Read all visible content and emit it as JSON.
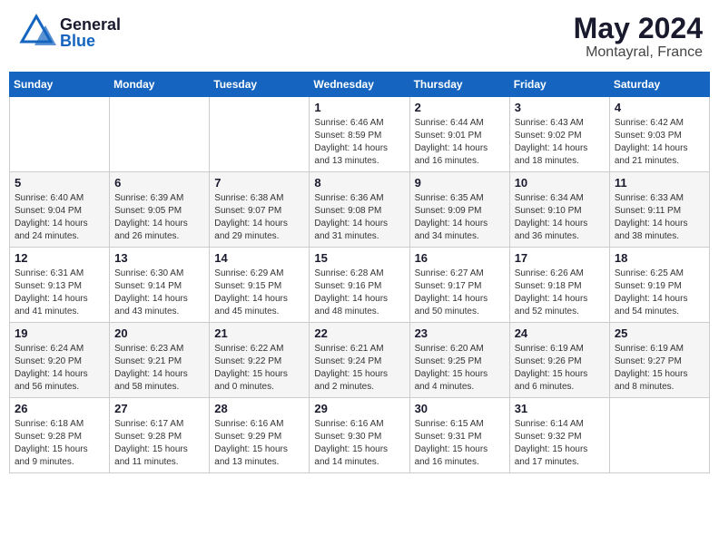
{
  "header": {
    "logo_general": "General",
    "logo_blue": "Blue",
    "month_year": "May 2024",
    "location": "Montayral, France"
  },
  "weekdays": [
    "Sunday",
    "Monday",
    "Tuesday",
    "Wednesday",
    "Thursday",
    "Friday",
    "Saturday"
  ],
  "weeks": [
    {
      "days": [
        {
          "number": "",
          "info": ""
        },
        {
          "number": "",
          "info": ""
        },
        {
          "number": "",
          "info": ""
        },
        {
          "number": "1",
          "sunrise": "Sunrise: 6:46 AM",
          "sunset": "Sunset: 8:59 PM",
          "daylight": "Daylight: 14 hours and 13 minutes."
        },
        {
          "number": "2",
          "sunrise": "Sunrise: 6:44 AM",
          "sunset": "Sunset: 9:01 PM",
          "daylight": "Daylight: 14 hours and 16 minutes."
        },
        {
          "number": "3",
          "sunrise": "Sunrise: 6:43 AM",
          "sunset": "Sunset: 9:02 PM",
          "daylight": "Daylight: 14 hours and 18 minutes."
        },
        {
          "number": "4",
          "sunrise": "Sunrise: 6:42 AM",
          "sunset": "Sunset: 9:03 PM",
          "daylight": "Daylight: 14 hours and 21 minutes."
        }
      ]
    },
    {
      "days": [
        {
          "number": "5",
          "sunrise": "Sunrise: 6:40 AM",
          "sunset": "Sunset: 9:04 PM",
          "daylight": "Daylight: 14 hours and 24 minutes."
        },
        {
          "number": "6",
          "sunrise": "Sunrise: 6:39 AM",
          "sunset": "Sunset: 9:05 PM",
          "daylight": "Daylight: 14 hours and 26 minutes."
        },
        {
          "number": "7",
          "sunrise": "Sunrise: 6:38 AM",
          "sunset": "Sunset: 9:07 PM",
          "daylight": "Daylight: 14 hours and 29 minutes."
        },
        {
          "number": "8",
          "sunrise": "Sunrise: 6:36 AM",
          "sunset": "Sunset: 9:08 PM",
          "daylight": "Daylight: 14 hours and 31 minutes."
        },
        {
          "number": "9",
          "sunrise": "Sunrise: 6:35 AM",
          "sunset": "Sunset: 9:09 PM",
          "daylight": "Daylight: 14 hours and 34 minutes."
        },
        {
          "number": "10",
          "sunrise": "Sunrise: 6:34 AM",
          "sunset": "Sunset: 9:10 PM",
          "daylight": "Daylight: 14 hours and 36 minutes."
        },
        {
          "number": "11",
          "sunrise": "Sunrise: 6:33 AM",
          "sunset": "Sunset: 9:11 PM",
          "daylight": "Daylight: 14 hours and 38 minutes."
        }
      ]
    },
    {
      "days": [
        {
          "number": "12",
          "sunrise": "Sunrise: 6:31 AM",
          "sunset": "Sunset: 9:13 PM",
          "daylight": "Daylight: 14 hours and 41 minutes."
        },
        {
          "number": "13",
          "sunrise": "Sunrise: 6:30 AM",
          "sunset": "Sunset: 9:14 PM",
          "daylight": "Daylight: 14 hours and 43 minutes."
        },
        {
          "number": "14",
          "sunrise": "Sunrise: 6:29 AM",
          "sunset": "Sunset: 9:15 PM",
          "daylight": "Daylight: 14 hours and 45 minutes."
        },
        {
          "number": "15",
          "sunrise": "Sunrise: 6:28 AM",
          "sunset": "Sunset: 9:16 PM",
          "daylight": "Daylight: 14 hours and 48 minutes."
        },
        {
          "number": "16",
          "sunrise": "Sunrise: 6:27 AM",
          "sunset": "Sunset: 9:17 PM",
          "daylight": "Daylight: 14 hours and 50 minutes."
        },
        {
          "number": "17",
          "sunrise": "Sunrise: 6:26 AM",
          "sunset": "Sunset: 9:18 PM",
          "daylight": "Daylight: 14 hours and 52 minutes."
        },
        {
          "number": "18",
          "sunrise": "Sunrise: 6:25 AM",
          "sunset": "Sunset: 9:19 PM",
          "daylight": "Daylight: 14 hours and 54 minutes."
        }
      ]
    },
    {
      "days": [
        {
          "number": "19",
          "sunrise": "Sunrise: 6:24 AM",
          "sunset": "Sunset: 9:20 PM",
          "daylight": "Daylight: 14 hours and 56 minutes."
        },
        {
          "number": "20",
          "sunrise": "Sunrise: 6:23 AM",
          "sunset": "Sunset: 9:21 PM",
          "daylight": "Daylight: 14 hours and 58 minutes."
        },
        {
          "number": "21",
          "sunrise": "Sunrise: 6:22 AM",
          "sunset": "Sunset: 9:22 PM",
          "daylight": "Daylight: 15 hours and 0 minutes."
        },
        {
          "number": "22",
          "sunrise": "Sunrise: 6:21 AM",
          "sunset": "Sunset: 9:24 PM",
          "daylight": "Daylight: 15 hours and 2 minutes."
        },
        {
          "number": "23",
          "sunrise": "Sunrise: 6:20 AM",
          "sunset": "Sunset: 9:25 PM",
          "daylight": "Daylight: 15 hours and 4 minutes."
        },
        {
          "number": "24",
          "sunrise": "Sunrise: 6:19 AM",
          "sunset": "Sunset: 9:26 PM",
          "daylight": "Daylight: 15 hours and 6 minutes."
        },
        {
          "number": "25",
          "sunrise": "Sunrise: 6:19 AM",
          "sunset": "Sunset: 9:27 PM",
          "daylight": "Daylight: 15 hours and 8 minutes."
        }
      ]
    },
    {
      "days": [
        {
          "number": "26",
          "sunrise": "Sunrise: 6:18 AM",
          "sunset": "Sunset: 9:28 PM",
          "daylight": "Daylight: 15 hours and 9 minutes."
        },
        {
          "number": "27",
          "sunrise": "Sunrise: 6:17 AM",
          "sunset": "Sunset: 9:28 PM",
          "daylight": "Daylight: 15 hours and 11 minutes."
        },
        {
          "number": "28",
          "sunrise": "Sunrise: 6:16 AM",
          "sunset": "Sunset: 9:29 PM",
          "daylight": "Daylight: 15 hours and 13 minutes."
        },
        {
          "number": "29",
          "sunrise": "Sunrise: 6:16 AM",
          "sunset": "Sunset: 9:30 PM",
          "daylight": "Daylight: 15 hours and 14 minutes."
        },
        {
          "number": "30",
          "sunrise": "Sunrise: 6:15 AM",
          "sunset": "Sunset: 9:31 PM",
          "daylight": "Daylight: 15 hours and 16 minutes."
        },
        {
          "number": "31",
          "sunrise": "Sunrise: 6:14 AM",
          "sunset": "Sunset: 9:32 PM",
          "daylight": "Daylight: 15 hours and 17 minutes."
        },
        {
          "number": "",
          "info": ""
        }
      ]
    }
  ]
}
